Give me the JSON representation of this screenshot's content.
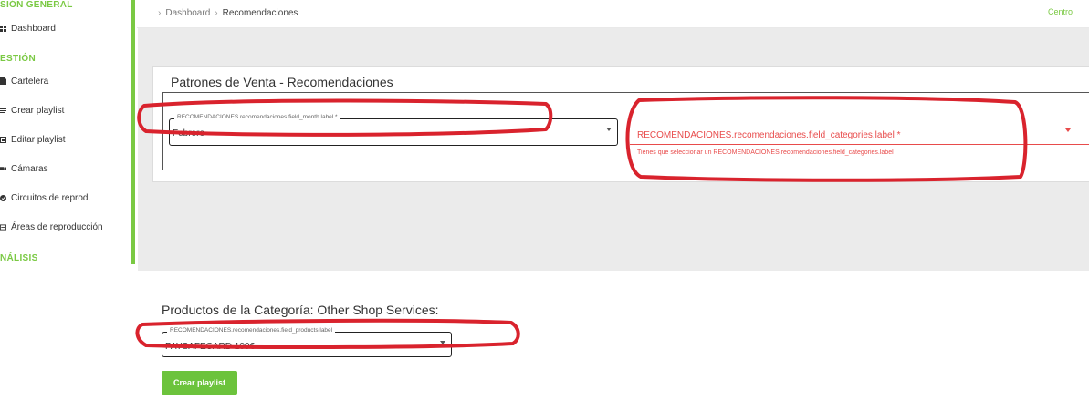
{
  "sidebar": {
    "sections": [
      {
        "title": "SIÓN GENERAL"
      },
      {
        "title": "ESTIÓN"
      },
      {
        "title": "NÁLISIS"
      }
    ],
    "items": [
      {
        "label": "Dashboard",
        "icon": "dashboard-icon"
      },
      {
        "label": "Cartelera",
        "icon": "document-icon"
      },
      {
        "label": "Crear playlist",
        "icon": "list-icon"
      },
      {
        "label": "Editar playlist",
        "icon": "edit-icon"
      },
      {
        "label": "Cámaras",
        "icon": "camera-icon"
      },
      {
        "label": "Circuitos de reprod.",
        "icon": "circuit-icon"
      },
      {
        "label": "Áreas de reproducción",
        "icon": "area-icon"
      }
    ],
    "accent_color": "#7ac943"
  },
  "breadcrumb": {
    "items": [
      "Dashboard",
      "Recomendaciones"
    ]
  },
  "topbar": {
    "right_text": "Centro"
  },
  "card": {
    "title": "Patrones de Venta - Recomendaciones"
  },
  "month_field": {
    "label": "RECOMENDACIONES.recomendaciones.field_month.label *",
    "value": "Febrero"
  },
  "category_field": {
    "label": "RECOMENDACIONES.recomendaciones.field_categories.label *",
    "error": "Tienes que seleccionar un RECOMENDACIONES.recomendaciones.field_categories.label",
    "error_color": "#e84b4b"
  },
  "products": {
    "title": "Productos de la Categoría: Other Shop Services:",
    "label": "RECOMENDACIONES.recomendaciones.field_products.label",
    "value": "PAYSAFECARD 100€"
  },
  "actions": {
    "create_playlist": "Crear playlist",
    "button_color": "#6cc33c"
  }
}
